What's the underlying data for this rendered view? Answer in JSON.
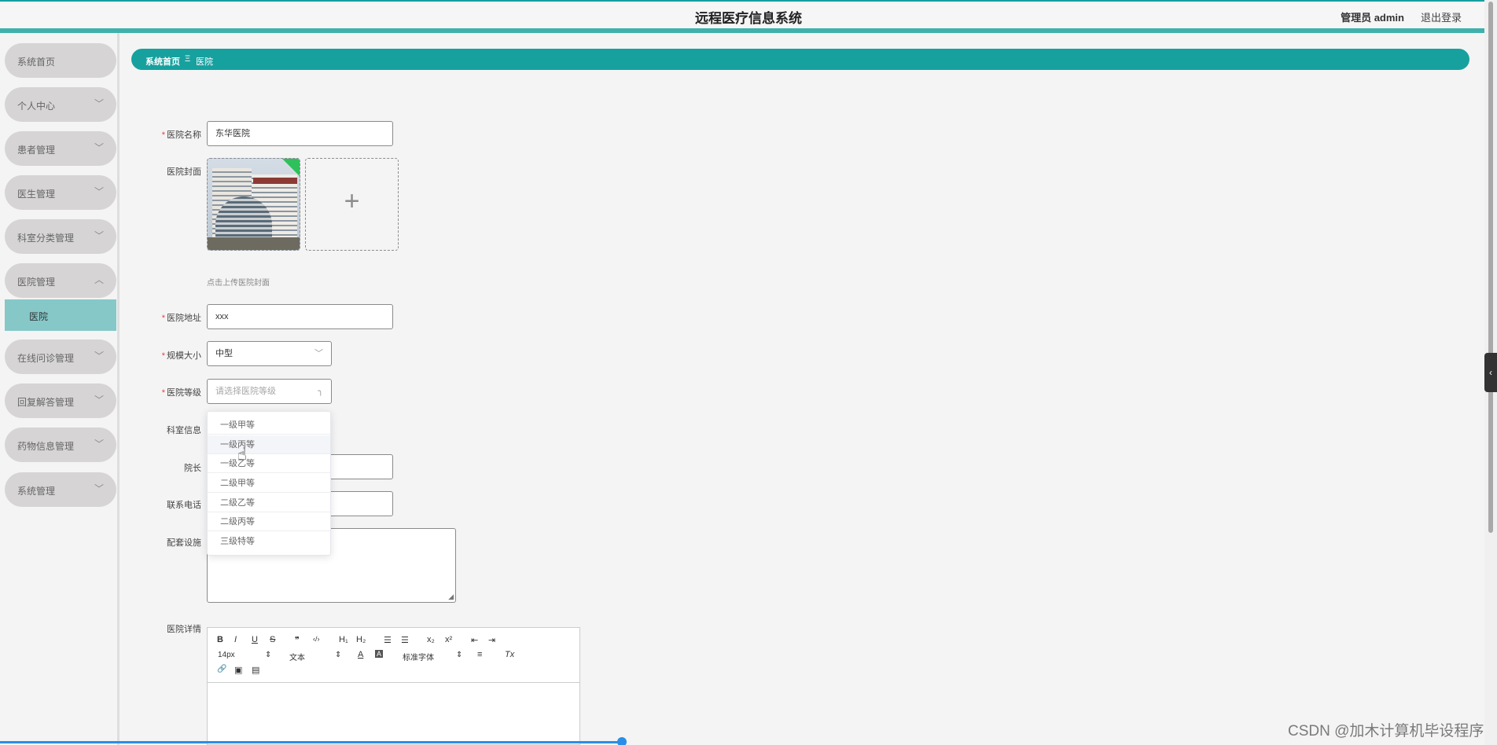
{
  "header": {
    "title": "远程医疗信息系统",
    "user": "管理员 admin",
    "logout": "退出登录"
  },
  "sidebar": {
    "items": [
      {
        "label": "系统首页",
        "chevron": ""
      },
      {
        "label": "个人中心",
        "chevron": "﹀"
      },
      {
        "label": "患者管理",
        "chevron": "﹀"
      },
      {
        "label": "医生管理",
        "chevron": "﹀"
      },
      {
        "label": "科室分类管理",
        "chevron": "﹀"
      },
      {
        "label": "医院管理",
        "chevron": "︿"
      },
      {
        "label": "在线问诊管理",
        "chevron": "﹀"
      },
      {
        "label": "回复解答管理",
        "chevron": "﹀"
      },
      {
        "label": "药物信息管理",
        "chevron": "﹀"
      },
      {
        "label": "系统管理",
        "chevron": "﹀"
      }
    ],
    "active_sub": "医院"
  },
  "breadcrumb": {
    "home": "系统首页",
    "sep": "Ξ",
    "current": "医院"
  },
  "form": {
    "name_label": "医院名称",
    "name_value": "东华医院",
    "cover_label": "医院封面",
    "cover_hint": "点击上传医院封面",
    "address_label": "医院地址",
    "address_value": "xxx",
    "size_label": "规模大小",
    "size_value": "中型",
    "level_label": "医院等级",
    "level_placeholder": "请选择医院等级",
    "dept_label": "科室信息",
    "dean_label": "院长",
    "phone_label": "联系电话",
    "facilities_label": "配套设施",
    "detail_label": "医院详情",
    "required_mark": "*",
    "plus": "+"
  },
  "dropdown": {
    "options": [
      "一级甲等",
      "一级丙等",
      "一级乙等",
      "二级甲等",
      "二级乙等",
      "二级丙等",
      "三级特等"
    ]
  },
  "editor": {
    "bold": "B",
    "italic": "I",
    "underline": "U",
    "strike": "S",
    "quote": "❞",
    "code": "‹/›",
    "h1": "H₁",
    "h2": "H₂",
    "ol": "☰",
    "ul": "☰",
    "sub": "x₂",
    "sup": "x²",
    "outdent": "⇤",
    "indent": "⇥",
    "font_size": "14px",
    "block": "文本",
    "font_family": "标准字体",
    "color": "A",
    "bg": "A",
    "align": "≡",
    "clear": "Tx",
    "link": "🔗",
    "image": "▣",
    "video": "▤",
    "select_arrow": "⇕"
  },
  "watermark": "CSDN @加木计算机毕设程序"
}
